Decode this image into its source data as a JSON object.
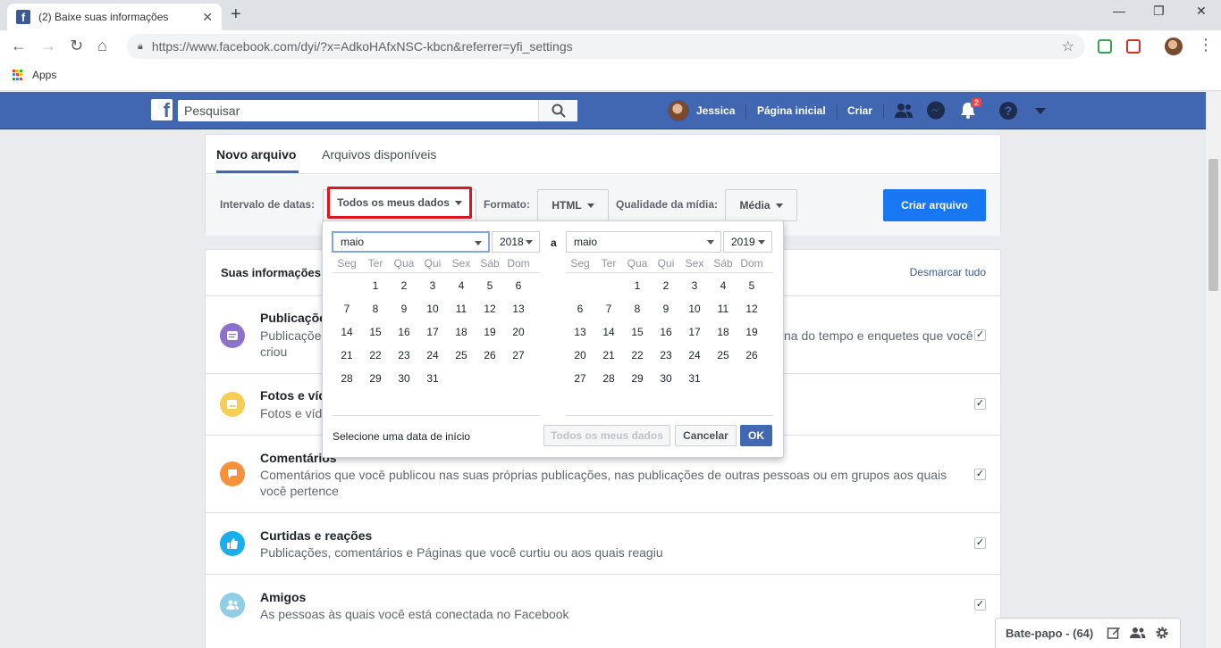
{
  "browser": {
    "tab_title": "(2) Baixe suas informações",
    "url": "https://www.facebook.com/dyi/?x=AdkoHAfxNSC-kbcn&referrer=yfi_settings",
    "bookmarks": {
      "apps_label": "Apps"
    }
  },
  "header": {
    "search_placeholder": "Pesquisar",
    "user_name": "Jessica",
    "home_label": "Página inicial",
    "create_label": "Criar",
    "notification_count": "2"
  },
  "tabs": [
    {
      "label": "Novo arquivo",
      "active": true
    },
    {
      "label": "Arquivos disponíveis",
      "active": false
    }
  ],
  "filters": {
    "date_range_label": "Intervalo de datas:",
    "date_range_value": "Todos os meus dados",
    "format_label": "Formato:",
    "format_value": "HTML",
    "media_quality_label": "Qualidade da mídia:",
    "media_quality_value": "Média",
    "create_button": "Criar arquivo"
  },
  "datepicker": {
    "start": {
      "month": "maio",
      "year": "2018"
    },
    "separator": "a",
    "end": {
      "month": "maio",
      "year": "2019"
    },
    "weekdays": [
      "Seg",
      "Ter",
      "Qua",
      "Qui",
      "Sex",
      "Sáb",
      "Dom"
    ],
    "start_days": [
      "",
      "1",
      "2",
      "3",
      "4",
      "5",
      "6",
      "7",
      "8",
      "9",
      "10",
      "11",
      "12",
      "13",
      "14",
      "15",
      "16",
      "17",
      "18",
      "19",
      "20",
      "21",
      "22",
      "23",
      "24",
      "25",
      "26",
      "27",
      "28",
      "29",
      "30",
      "31"
    ],
    "end_days": [
      "",
      "",
      "1",
      "2",
      "3",
      "4",
      "5",
      "6",
      "7",
      "8",
      "9",
      "10",
      "11",
      "12",
      "13",
      "14",
      "15",
      "16",
      "17",
      "18",
      "19",
      "20",
      "21",
      "22",
      "23",
      "24",
      "25",
      "26",
      "27",
      "28",
      "29",
      "30",
      "31"
    ],
    "hint": "Selecione uma data de início",
    "all_data_button": "Todos os meus dados",
    "cancel_button": "Cancelar",
    "ok_button": "OK"
  },
  "info": {
    "heading": "Suas informações",
    "deselect_all": "Desmarcar tudo",
    "items": [
      {
        "title": "Publicações",
        "desc_left": "Publicações",
        "desc_right": "na do tempo e enquetes que você",
        "desc_line2": "criou",
        "icon": "post-icon",
        "color": "#8c72cb"
      },
      {
        "title": "Fotos e vídeos",
        "desc_left": "Fotos e víd",
        "icon": "photo-icon",
        "color": "#f7cd56"
      },
      {
        "title": "Comentários",
        "desc": "Comentários que você publicou nas suas próprias publicações, nas publicações de outras pessoas ou em grupos aos quais você pertence",
        "icon": "comment-icon",
        "color": "#f7923b"
      },
      {
        "title": "Curtidas e reações",
        "desc": "Publicações, comentários e Páginas que você curtiu ou aos quais reagiu",
        "icon": "like-icon",
        "color": "#1aaeee"
      },
      {
        "title": "Amigos",
        "desc": "As pessoas às quais você está conectada no Facebook",
        "icon": "friends-icon",
        "color": "#8fcee7"
      }
    ]
  },
  "chat": {
    "label": "Bate-papo - (64)"
  }
}
